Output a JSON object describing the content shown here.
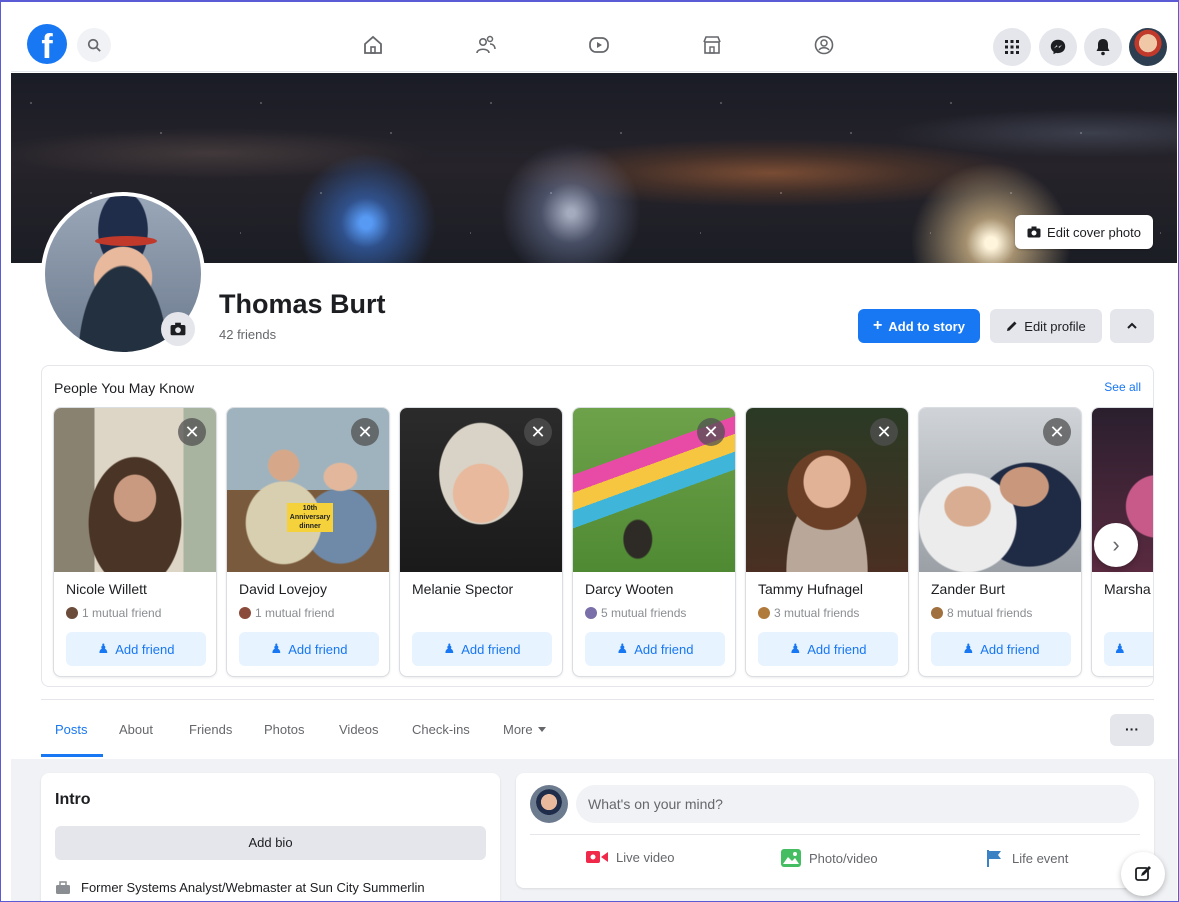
{
  "nav": {
    "logo_letter": "f",
    "icons": [
      "home-icon",
      "friends-icon",
      "watch-icon",
      "marketplace-icon",
      "groups-icon"
    ],
    "right_icons": [
      "menu-grid-icon",
      "messenger-icon",
      "notifications-icon"
    ]
  },
  "cover": {
    "edit_label": "Edit cover photo"
  },
  "profile": {
    "name": "Thomas Burt",
    "friends": "42 friends",
    "add_story_label": "Add to story",
    "edit_profile_label": "Edit profile"
  },
  "pymk": {
    "title": "People You May Know",
    "see_all": "See all",
    "add_label": "Add friend",
    "cards": [
      {
        "name": "Nicole Willett",
        "mutual": "1 mutual friend",
        "has_mutual": true
      },
      {
        "name": "David Lovejoy",
        "mutual": "1 mutual friend",
        "has_mutual": true,
        "photo_caption": "10th Anniversary dinner"
      },
      {
        "name": "Melanie Spector",
        "mutual": "",
        "has_mutual": false
      },
      {
        "name": "Darcy Wooten",
        "mutual": "5 mutual friends",
        "has_mutual": true
      },
      {
        "name": "Tammy Hufnagel",
        "mutual": "3 mutual friends",
        "has_mutual": true
      },
      {
        "name": "Zander Burt",
        "mutual": "8 mutual friends",
        "has_mutual": true
      },
      {
        "name": "Marsha",
        "mutual": "",
        "has_mutual": false
      }
    ]
  },
  "tabs": {
    "items": [
      "Posts",
      "About",
      "Friends",
      "Photos",
      "Videos",
      "Check-ins",
      "More"
    ],
    "more_dots": "···"
  },
  "intro": {
    "title": "Intro",
    "add_bio": "Add bio",
    "work": "Former Systems Analyst/Webmaster at Sun City Summerlin"
  },
  "composer": {
    "placeholder": "What's on your mind?",
    "live_video": "Live video",
    "photo_video": "Photo/video",
    "life_event": "Life event"
  },
  "colors": {
    "brand": "#1877f2",
    "live_red": "#f02849",
    "photo_green": "#45bd62",
    "event_blue": "#3b82c4"
  }
}
